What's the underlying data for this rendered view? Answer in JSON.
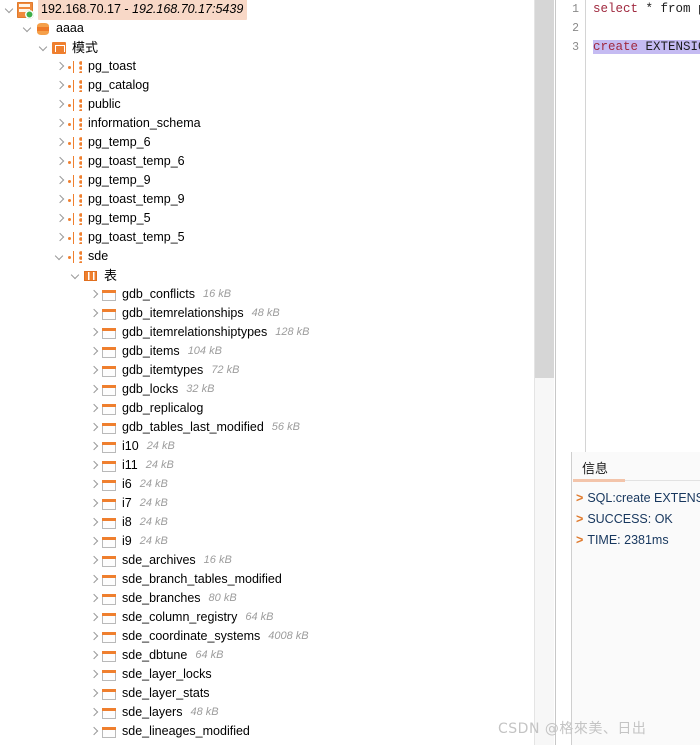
{
  "tree": {
    "connection": {
      "label": "192.168.70.17",
      "separator": " - ",
      "host": "192.168.70.17:5439",
      "icon": "server-connected-icon",
      "selected": true
    },
    "database": {
      "label": "aaaa",
      "icon": "database-icon"
    },
    "schemas_group": {
      "label": "模式",
      "icon": "schema-folder-icon"
    },
    "schemas": [
      {
        "label": "pg_toast",
        "expanded": false
      },
      {
        "label": "pg_catalog",
        "expanded": false
      },
      {
        "label": "public",
        "expanded": false
      },
      {
        "label": "information_schema",
        "expanded": false
      },
      {
        "label": "pg_temp_6",
        "expanded": false
      },
      {
        "label": "pg_toast_temp_6",
        "expanded": false
      },
      {
        "label": "pg_temp_9",
        "expanded": false
      },
      {
        "label": "pg_toast_temp_9",
        "expanded": false
      },
      {
        "label": "pg_temp_5",
        "expanded": false
      },
      {
        "label": "pg_toast_temp_5",
        "expanded": false
      },
      {
        "label": "sde",
        "expanded": true
      }
    ],
    "tables_group": {
      "label": "表",
      "icon": "table-group-icon"
    },
    "tables": [
      {
        "label": "gdb_conflicts",
        "size": "16 kB"
      },
      {
        "label": "gdb_itemrelationships",
        "size": "48 kB"
      },
      {
        "label": "gdb_itemrelationshiptypes",
        "size": "128 kB"
      },
      {
        "label": "gdb_items",
        "size": "104 kB"
      },
      {
        "label": "gdb_itemtypes",
        "size": "72 kB"
      },
      {
        "label": "gdb_locks",
        "size": "32 kB"
      },
      {
        "label": "gdb_replicalog",
        "size": ""
      },
      {
        "label": "gdb_tables_last_modified",
        "size": "56 kB"
      },
      {
        "label": "i10",
        "size": "24 kB"
      },
      {
        "label": "i11",
        "size": "24 kB"
      },
      {
        "label": "i6",
        "size": "24 kB"
      },
      {
        "label": "i7",
        "size": "24 kB"
      },
      {
        "label": "i8",
        "size": "24 kB"
      },
      {
        "label": "i9",
        "size": "24 kB"
      },
      {
        "label": "sde_archives",
        "size": "16 kB"
      },
      {
        "label": "sde_branch_tables_modified",
        "size": ""
      },
      {
        "label": "sde_branches",
        "size": "80 kB"
      },
      {
        "label": "sde_column_registry",
        "size": "64 kB"
      },
      {
        "label": "sde_coordinate_systems",
        "size": "4008 kB"
      },
      {
        "label": "sde_dbtune",
        "size": "64 kB"
      },
      {
        "label": "sde_layer_locks",
        "size": ""
      },
      {
        "label": "sde_layer_stats",
        "size": ""
      },
      {
        "label": "sde_layers",
        "size": "48 kB"
      },
      {
        "label": "sde_lineages_modified",
        "size": ""
      }
    ]
  },
  "editor": {
    "gutter": [
      "1",
      "2",
      "3"
    ],
    "lines": [
      {
        "keyword": "select",
        "rest": " * from p"
      },
      {
        "keyword": "",
        "rest": ""
      },
      {
        "keyword": "create",
        "rest": " EXTENSIO",
        "selected": true
      }
    ]
  },
  "messages": {
    "tab_label": "信息",
    "lines": [
      {
        "arrow": ">",
        "text": "SQL:create EXTENSIO"
      },
      {
        "arrow": ">",
        "text": "SUCCESS: OK"
      },
      {
        "arrow": ">",
        "text": "TIME: 2381ms"
      }
    ]
  },
  "watermark": {
    "text": "CSDN @格來美、日出"
  },
  "colors": {
    "accent_orange": "#ef7f2e",
    "selection_peach": "#f8d8c7",
    "keyword_red": "#a0293f",
    "code_selection": "#c5bbf2",
    "message_blue": "#17375e"
  }
}
